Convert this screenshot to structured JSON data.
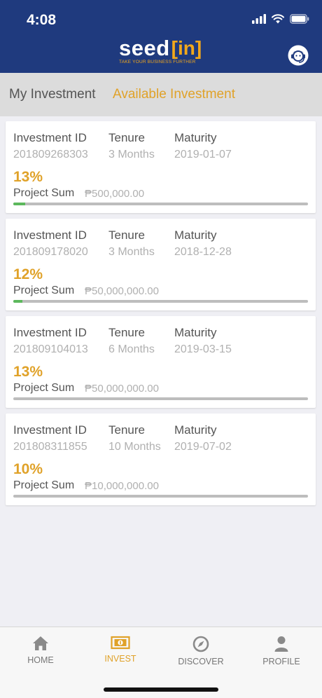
{
  "status_bar": {
    "time": "4:08"
  },
  "header": {
    "logo_text": "seed",
    "logo_accent": "[in]",
    "tagline": "TAKE YOUR BUSINESS FURTHER",
    "support_icon": "support-agent-icon"
  },
  "tabs": [
    {
      "label": "My Investment",
      "active": false
    },
    {
      "label": "Available Investment",
      "active": true
    }
  ],
  "labels": {
    "investment_id": "Investment  ID",
    "tenure": "Tenure",
    "maturity": "Maturity",
    "project_sum": "Project Sum"
  },
  "investments": [
    {
      "id": "201809268303",
      "tenure": "3 Months",
      "maturity": "2019-01-07",
      "rate": "13%",
      "sum": "₱500,000.00",
      "progress": 0.04
    },
    {
      "id": "201809178020",
      "tenure": "3 Months",
      "maturity": "2018-12-28",
      "rate": "12%",
      "sum": "₱50,000,000.00",
      "progress": 0.03
    },
    {
      "id": "201809104013",
      "tenure": "6 Months",
      "maturity": "2019-03-15",
      "rate": "13%",
      "sum": "₱50,000,000.00",
      "progress": 0
    },
    {
      "id": "201808311855",
      "tenure": "10 Months",
      "maturity": "2019-07-02",
      "rate": "10%",
      "sum": "₱10,000,000.00",
      "progress": 0
    }
  ],
  "bottom_nav": [
    {
      "label": "HOME",
      "icon": "home-icon",
      "active": false
    },
    {
      "label": "INVEST",
      "icon": "money-icon",
      "active": true
    },
    {
      "label": "DISCOVER",
      "icon": "compass-icon",
      "active": false
    },
    {
      "label": "PROFILE",
      "icon": "person-icon",
      "active": false
    }
  ],
  "colors": {
    "header_bg": "#1f3a7e",
    "accent": "#e0a229",
    "progress": "#5cb85c"
  }
}
